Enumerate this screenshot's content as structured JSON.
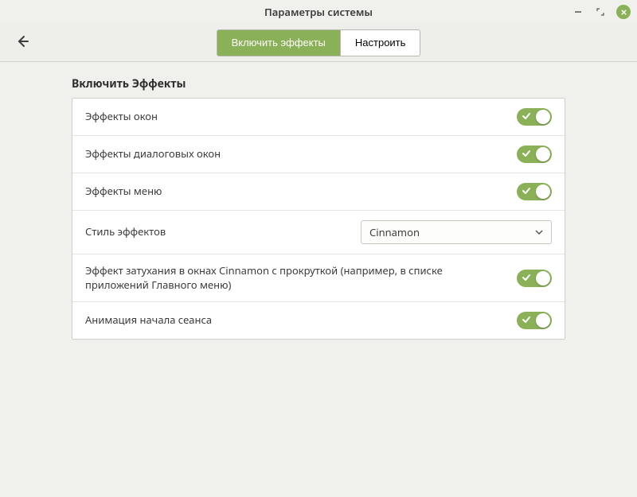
{
  "window": {
    "title": "Параметры системы"
  },
  "toolbar": {
    "tab_enable": "Включить эффекты",
    "tab_configure": "Настроить"
  },
  "section": {
    "title": "Включить Эффекты"
  },
  "rows": {
    "window_effects": "Эффекты окон",
    "dialog_effects": "Эффекты диалоговых окон",
    "menu_effects": "Эффекты меню",
    "effects_style": "Стиль эффектов",
    "fade_scroll": "Эффект затухания в окнах Cinnamon с прокруткой (например, в списке приложений Главного меню)",
    "session_anim": "Анимация начала сеанса"
  },
  "combo": {
    "effects_style_value": "Cinnamon"
  }
}
